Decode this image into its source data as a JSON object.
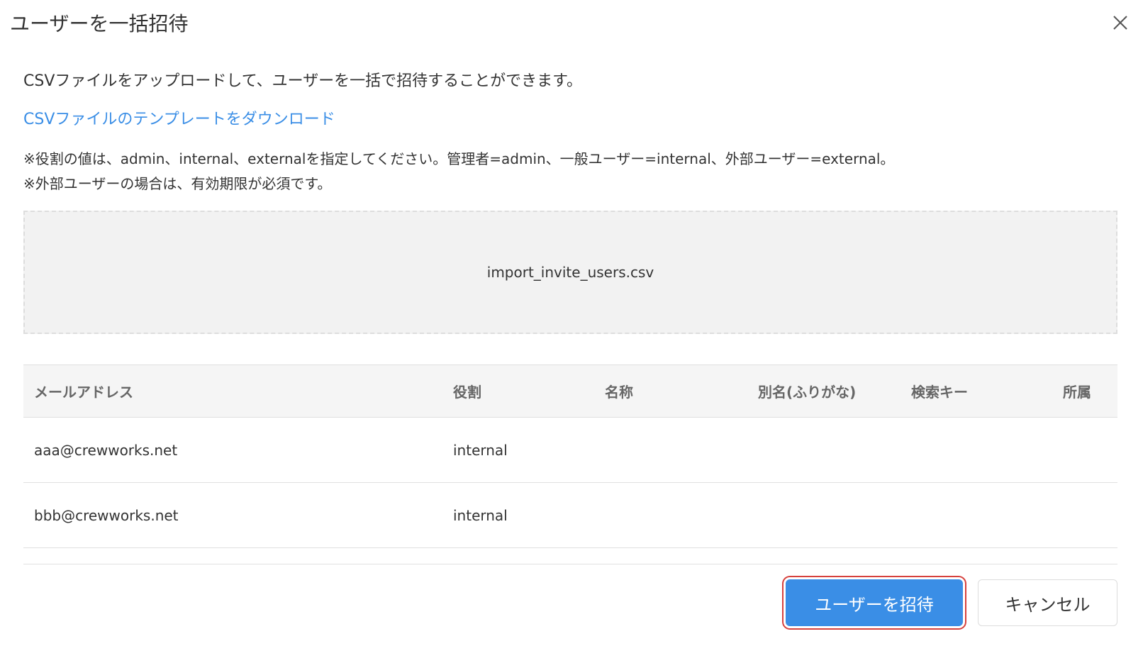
{
  "dialog": {
    "title": "ユーザーを一括招待",
    "description": "CSVファイルをアップロードして、ユーザーを一括で招待することができます。",
    "template_link": "CSVファイルのテンプレートをダウンロード",
    "note_role": "※役割の値は、admin、internal、externalを指定してください。管理者=admin、一般ユーザー=internal、外部ユーザー=external。",
    "note_expiry": "※外部ユーザーの場合は、有効期限が必須です。",
    "upload": {
      "filename": "import_invite_users.csv"
    },
    "table": {
      "columns": [
        "メールアドレス",
        "役割",
        "名称",
        "別名(ふりがな)",
        "検索キー",
        "所属"
      ],
      "rows": [
        [
          "aaa@crewworks.net",
          "internal",
          "",
          "",
          "",
          ""
        ],
        [
          "bbb@crewworks.net",
          "internal",
          "",
          "",
          "",
          ""
        ]
      ]
    },
    "buttons": {
      "invite": "ユーザーを招待",
      "cancel": "キャンセル"
    }
  },
  "icons": {
    "close": "close-icon"
  },
  "colors": {
    "accent": "#3a8ee6",
    "focus_ring": "#d6413d",
    "table_header_bg": "#f5f5f5",
    "dropzone_bg": "#f2f2f2"
  }
}
